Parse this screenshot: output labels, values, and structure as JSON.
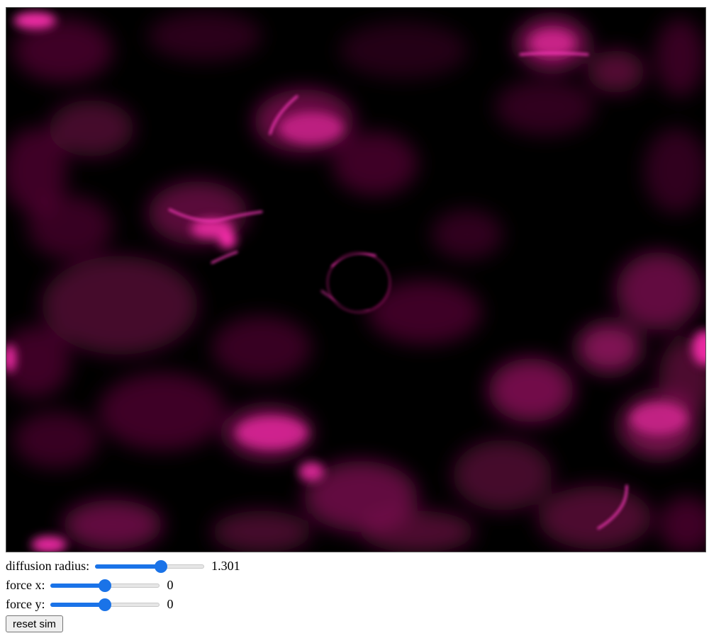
{
  "canvas": {
    "background": "#000000",
    "tint": "#ff1fa8"
  },
  "controls": {
    "diffusion_radius": {
      "label": "diffusion radius:",
      "value_text": "1.301",
      "fraction": 0.62
    },
    "force_x": {
      "label": "force x:",
      "value_text": "0",
      "fraction": 0.5
    },
    "force_y": {
      "label": "force y:",
      "value_text": "0",
      "fraction": 0.5
    },
    "reset_button": {
      "label": "reset sim"
    }
  },
  "colors": {
    "accent": "#1a73e8",
    "track": "#e6e6e6"
  }
}
